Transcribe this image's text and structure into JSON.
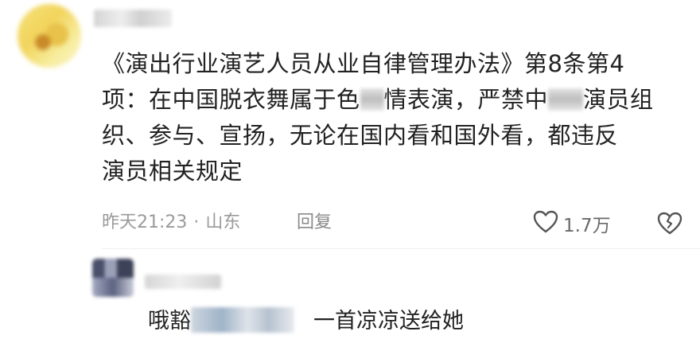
{
  "comment": {
    "text_line1": "《演出行业演艺人员从业自律管理办法》第8条第4",
    "text_line2_a": "项：在中国脱衣舞属于色",
    "text_line2_b": "情表演，严禁中",
    "text_line2_c": "演员组",
    "text_line3": "织、参与、宣扬，无论在国内看和国外看，都违反",
    "text_line4": "演员相关规定",
    "time": "昨天21:23",
    "separator": "·",
    "location": "山东",
    "reply_label": "回复",
    "like_count": "1.7万"
  },
  "reply": {
    "text_prefix": "哦豁",
    "text_suffix": "一首凉凉送给她"
  },
  "colors": {
    "text": "#222222",
    "meta": "#9a9a9a",
    "icon": "#555555"
  },
  "icons": {
    "like": "heart-outline-icon",
    "dislike": "broken-heart-icon"
  }
}
